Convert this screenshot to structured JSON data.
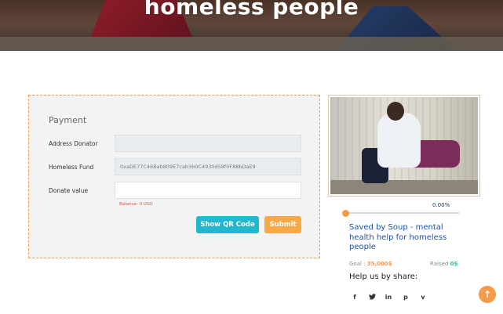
{
  "hero": {
    "title": "homeless people"
  },
  "form": {
    "heading": "Payment",
    "address_label": "Address Donator",
    "address_value": "",
    "fund_label": "Homeless Fund",
    "fund_value": "0xaDE77C46Bab809E7cab3b0C4930d58f0F88bDaE9",
    "donate_label": "Donate value",
    "donate_value": "",
    "balance_text": "Balance: 0 USD",
    "qr_button": "Show QR Code",
    "submit_button": "Submit"
  },
  "campaign": {
    "image_alt": "man sitting against wall with bag",
    "progress_percent": 0,
    "progress_label": "0.00%",
    "title": "Saved by Soup - mental health help for homeless people",
    "goal_label": "Goal : ",
    "goal_amount": "35,000$",
    "raised_label": "Raised ",
    "raised_amount": "0$",
    "share_title": "Help us by share:",
    "social": [
      {
        "icon": "facebook-icon",
        "glyph": "f"
      },
      {
        "icon": "twitter-icon",
        "glyph": "🐦"
      },
      {
        "icon": "linkedin-icon",
        "glyph": "in"
      },
      {
        "icon": "pinterest-icon",
        "glyph": "p"
      },
      {
        "icon": "vimeo-icon",
        "glyph": "v"
      }
    ]
  },
  "colors": {
    "accent": "#f39a4b",
    "cyan": "#1fb8cf",
    "link": "#1e4f9c"
  }
}
